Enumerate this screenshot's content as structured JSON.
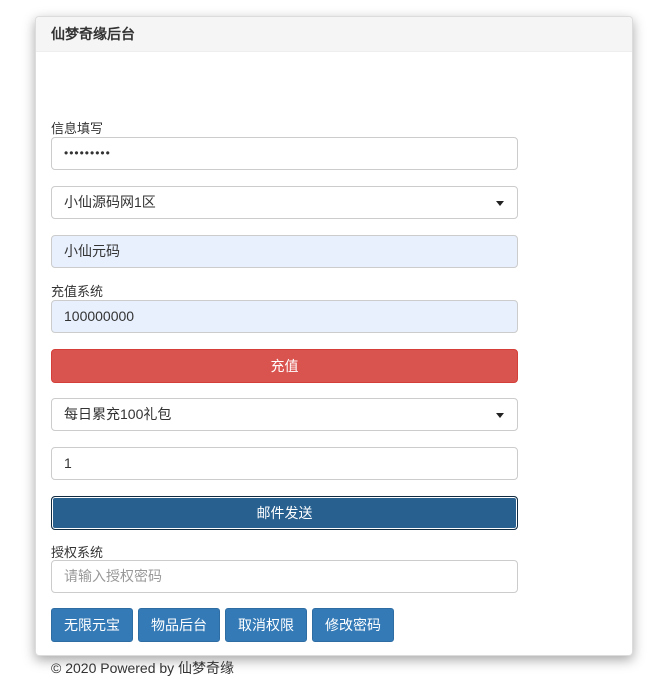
{
  "panel": {
    "title": "仙梦奇缘后台"
  },
  "info_section": {
    "label": "信息填写",
    "password_value": "•••••••••",
    "server_select_value": "小仙源码网1区",
    "role_name_value": "小仙元码"
  },
  "recharge_section": {
    "label": "充值系统",
    "amount_value": "100000000",
    "recharge_button": "充值"
  },
  "mail_section": {
    "item_select_value": "每日累充100礼包",
    "quantity_value": "1",
    "send_button": "邮件发送"
  },
  "auth_section": {
    "label": "授权系统",
    "auth_placeholder": "请输入授权密码",
    "buttons": [
      "无限元宝",
      "物品后台",
      "取消权限",
      "修改密码"
    ]
  },
  "footer": {
    "text": "© 2020 Powered by 仙梦奇缘"
  },
  "colors": {
    "primary": "#337ab7",
    "danger": "#d9534f",
    "autofill": "#e8f0fe",
    "active_primary": "#286090"
  }
}
